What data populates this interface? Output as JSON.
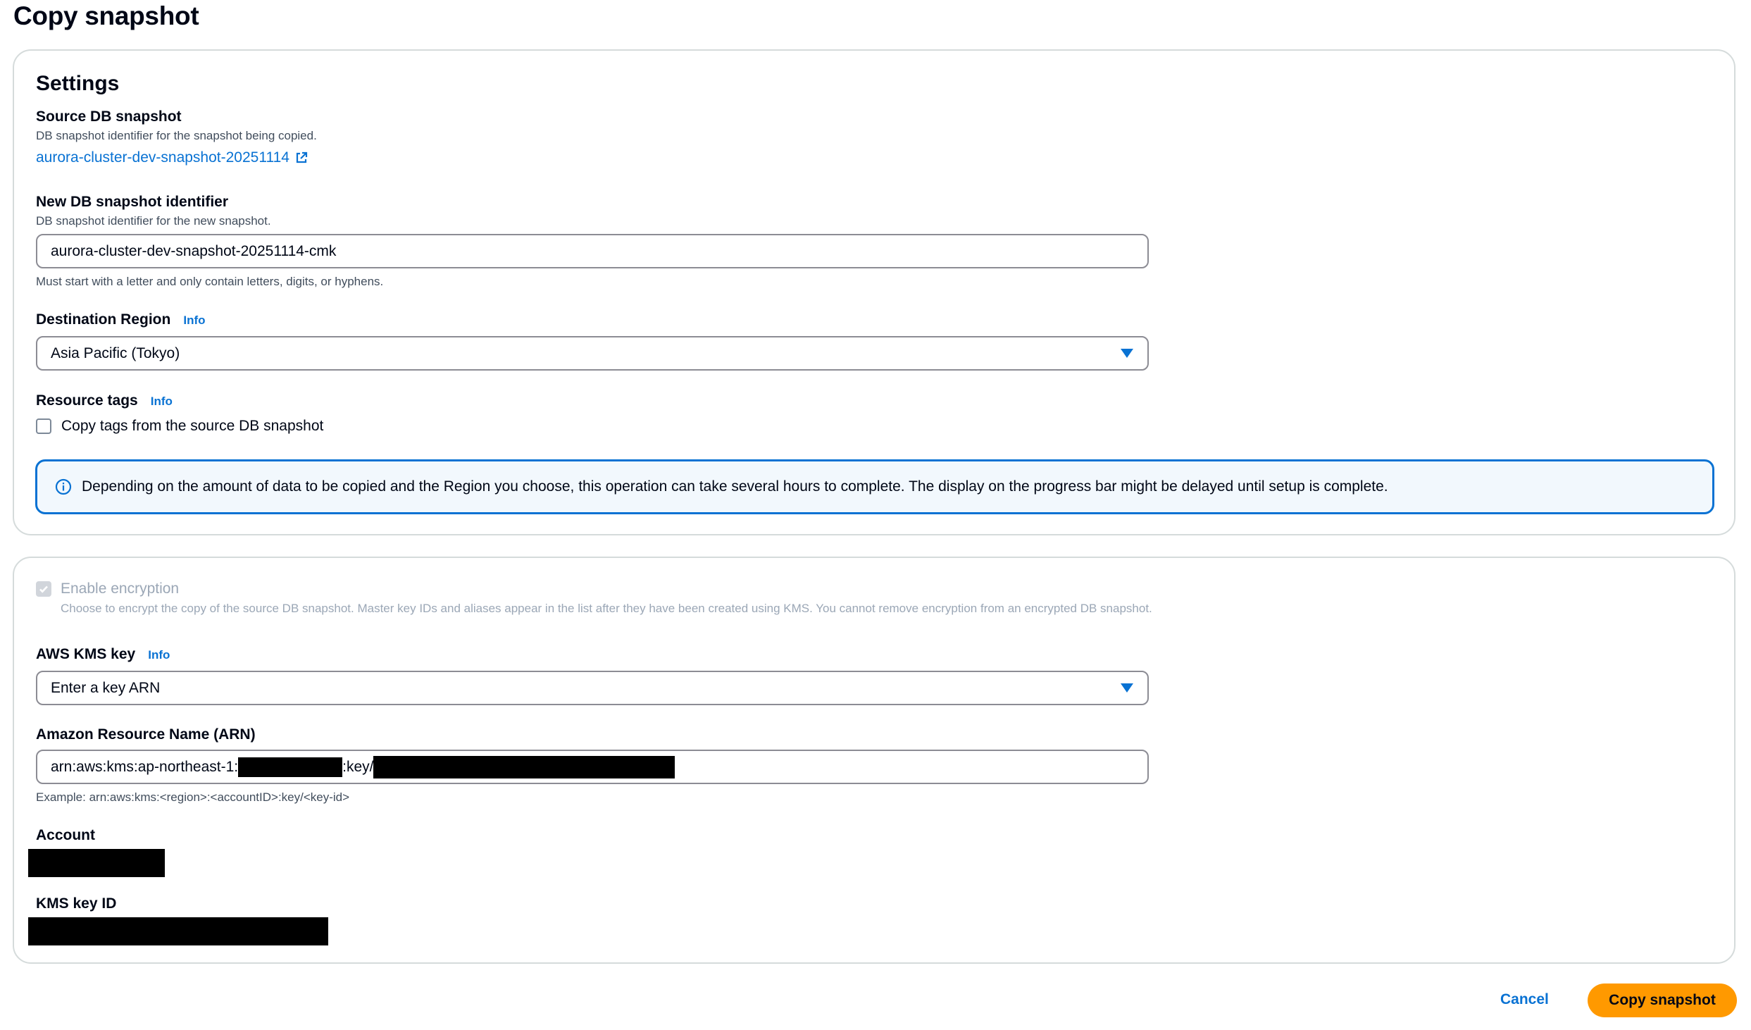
{
  "page": {
    "title": "Copy snapshot"
  },
  "settings": {
    "heading": "Settings",
    "source_snapshot": {
      "label": "Source DB snapshot",
      "description": "DB snapshot identifier for the snapshot being copied.",
      "link_text": "aurora-cluster-dev-snapshot-20251114"
    },
    "new_identifier": {
      "label": "New DB snapshot identifier",
      "description": "DB snapshot identifier for the new snapshot.",
      "value": "aurora-cluster-dev-snapshot-20251114-cmk",
      "constraint": "Must start with a letter and only contain letters, digits, or hyphens."
    },
    "destination_region": {
      "label": "Destination Region",
      "info": "Info",
      "selected": "Asia Pacific (Tokyo)"
    },
    "resource_tags": {
      "label": "Resource tags",
      "info": "Info",
      "checkbox_label": "Copy tags from the source DB snapshot",
      "checked": false
    },
    "alert_text": "Depending on the amount of data to be copied and the Region you choose, this operation can take several hours to complete. The display on the progress bar might be delayed until setup is complete."
  },
  "encryption": {
    "enable_label": "Enable encryption",
    "enable_description": "Choose to encrypt the copy of the source DB snapshot. Master key IDs and aliases appear in the list after they have been created using KMS. You cannot remove encryption from an encrypted DB snapshot.",
    "enabled": true,
    "kms_key": {
      "label": "AWS KMS key",
      "info": "Info",
      "selected": "Enter a key ARN"
    },
    "arn": {
      "label": "Amazon Resource Name (ARN)",
      "value_prefix": "arn:aws:kms:ap-northeast-1:",
      "value_middle": ":key/",
      "example": "Example: arn:aws:kms:<region>:<accountID>:key/<key-id>"
    },
    "account": {
      "label": "Account"
    },
    "kms_key_id": {
      "label": "KMS key ID"
    }
  },
  "footer": {
    "cancel_label": "Cancel",
    "submit_label": "Copy snapshot"
  },
  "colors": {
    "link": "#0972d3",
    "primary_button": "#ff9900",
    "alert_border": "#0972d3",
    "alert_background": "#f2f8fd"
  },
  "icons": {
    "external_link": "external-link-icon",
    "info": "info-circle-icon",
    "caret": "caret-down-icon",
    "check": "check-icon"
  }
}
